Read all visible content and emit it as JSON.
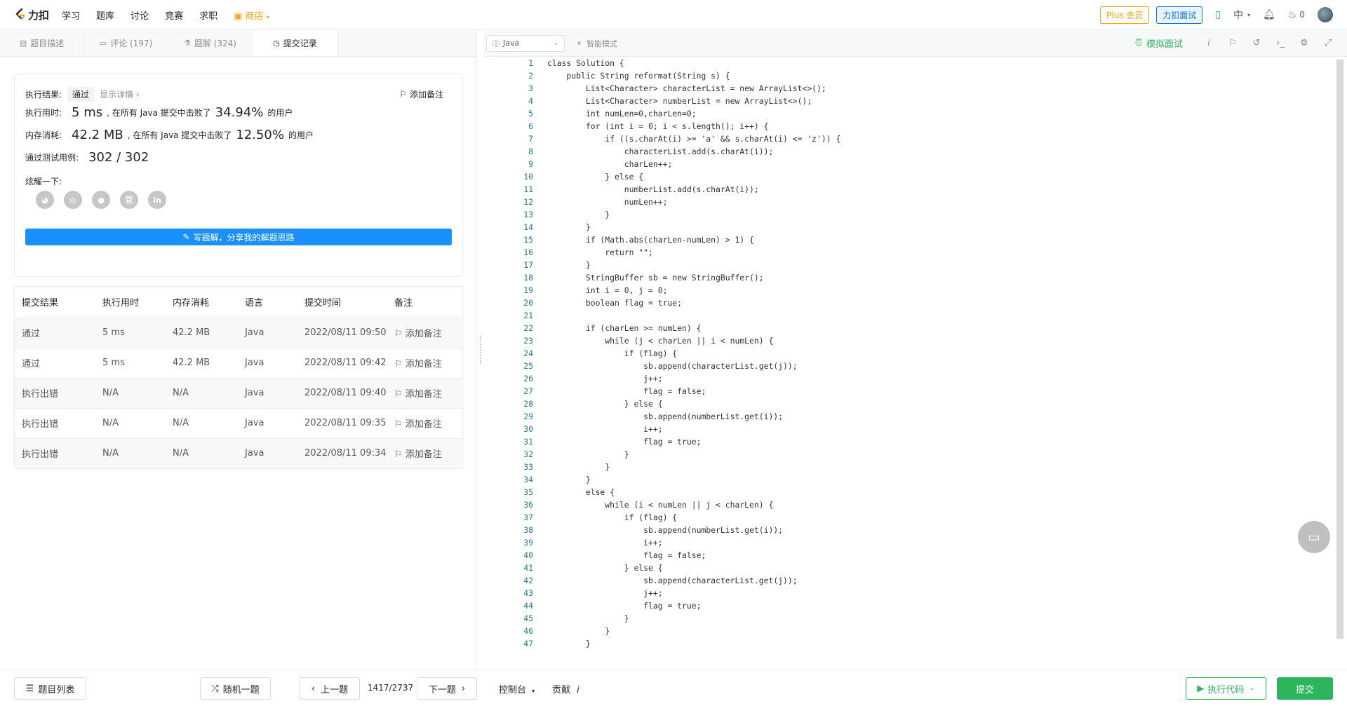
{
  "topbar": {
    "logo_text": "力扣",
    "nav": [
      "学习",
      "题库",
      "讨论",
      "竞赛",
      "求职"
    ],
    "shop": "商店",
    "plus": "Plus 会员",
    "mock": "力扣面试",
    "lang": "中",
    "points": "0"
  },
  "tabs": [
    {
      "label": "题目描述",
      "icon": "doc-icon"
    },
    {
      "label": "评论 (197)",
      "icon": "comment-icon"
    },
    {
      "label": "题解 (324)",
      "icon": "flask-icon"
    },
    {
      "label": "提交记录",
      "icon": "clock-icon"
    }
  ],
  "result": {
    "result_label": "执行结果:",
    "result_value": "通过",
    "detail_link": "显示详情 ›",
    "add_note": "添加备注",
    "time_label": "执行用时:",
    "time_value": "5 ms",
    "time_mid": ", 在所有 Java 提交中击败了",
    "time_pct": "34.94%",
    "time_tail": "的用户",
    "mem_label": "内存消耗:",
    "mem_value": "42.2 MB",
    "mem_mid": ", 在所有 Java 提交中击败了",
    "mem_pct": "12.50%",
    "mem_tail": "的用户",
    "cases_label": "通过测试用例:",
    "cases_value": "302 / 302",
    "share_label": "炫耀一下:",
    "write_btn": "写题解，分享我的解题思路"
  },
  "submissions": {
    "headers": [
      "提交结果",
      "执行用时",
      "内存消耗",
      "语言",
      "提交时间",
      "备注"
    ],
    "rows": [
      {
        "status": "通过",
        "ok": true,
        "time": "5 ms",
        "mem": "42.2 MB",
        "lang": "Java",
        "date": "2022/08/11 09:50",
        "note": "添加备注"
      },
      {
        "status": "通过",
        "ok": true,
        "time": "5 ms",
        "mem": "42.2 MB",
        "lang": "Java",
        "date": "2022/08/11 09:42",
        "note": "添加备注"
      },
      {
        "status": "执行出错",
        "ok": false,
        "time": "N/A",
        "mem": "N/A",
        "lang": "Java",
        "date": "2022/08/11 09:40",
        "note": "添加备注"
      },
      {
        "status": "执行出错",
        "ok": false,
        "time": "N/A",
        "mem": "N/A",
        "lang": "Java",
        "date": "2022/08/11 09:35",
        "note": "添加备注"
      },
      {
        "status": "执行出错",
        "ok": false,
        "time": "N/A",
        "mem": "N/A",
        "lang": "Java",
        "date": "2022/08/11 09:34",
        "note": "添加备注"
      }
    ]
  },
  "editor": {
    "language": "Java",
    "smart_mode": "智能模式",
    "mock_interview": "模拟面试",
    "code_lines": [
      "class Solution {",
      "    public String reformat(String s) {",
      "        List<Character> characterList = new ArrayList<>();",
      "        List<Character> numberList = new ArrayList<>();",
      "        int numLen=0,charLen=0;",
      "        for (int i = 0; i < s.length(); i++) {",
      "            if ((s.charAt(i) >= 'a' && s.charAt(i) <= 'z')) {",
      "                characterList.add(s.charAt(i));",
      "                charLen++;",
      "            } else {",
      "                numberList.add(s.charAt(i));",
      "                numLen++;",
      "            }",
      "        }",
      "        if (Math.abs(charLen-numLen) > 1) {",
      "            return \"\";",
      "        }",
      "        StringBuffer sb = new StringBuffer();",
      "        int i = 0, j = 0;",
      "        boolean flag = true;",
      "",
      "        if (charLen >= numLen) {",
      "            while (j < charLen || i < numLen) {",
      "                if (flag) {",
      "                    sb.append(characterList.get(j));",
      "                    j++;",
      "                    flag = false;",
      "                } else {",
      "                    sb.append(numberList.get(i));",
      "                    i++;",
      "                    flag = true;",
      "                }",
      "            }",
      "        }",
      "        else {",
      "            while (i < numLen || j < charLen) {",
      "                if (flag) {",
      "                    sb.append(numberList.get(i));",
      "                    i++;",
      "                    flag = false;",
      "                } else {",
      "                    sb.append(characterList.get(j));",
      "                    j++;",
      "                    flag = true;",
      "                }",
      "            }",
      "        }"
    ]
  },
  "bottom": {
    "problem_list": "题目列表",
    "random": "随机一题",
    "prev": "上一题",
    "page": "1417/2737",
    "next": "下一题",
    "console": "控制台",
    "contribute": "贡献",
    "run": "执行代码",
    "submit": "提交"
  },
  "colors": {
    "brand": "#ffa116",
    "pass": "#2db55d",
    "error": "#ef4743",
    "primary": "#1a90ff"
  }
}
